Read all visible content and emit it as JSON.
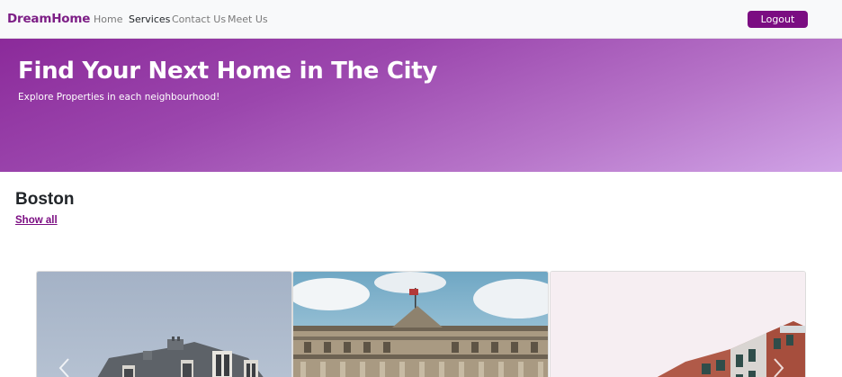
{
  "navbar": {
    "brand": "DreamHome",
    "links": [
      {
        "label": "Home",
        "active": false
      },
      {
        "label": "Services",
        "active": true
      },
      {
        "label": "Contact Us",
        "active": false
      },
      {
        "label": "Meet Us",
        "active": false
      }
    ],
    "logout_label": "Logout"
  },
  "hero": {
    "title": "Find Your Next Home in The City",
    "subtitle": "Explore Properties in each neighbourhood!"
  },
  "section": {
    "city": "Boston",
    "show_all_label": "Show all"
  },
  "carousel": {
    "prev_icon": "chevron-left-icon",
    "next_icon": "chevron-right-icon"
  },
  "colors": {
    "brand": "#7d1f86",
    "accent": "#7b0d82",
    "hero_start": "#8b2a9a",
    "hero_end": "#d0a3e6"
  }
}
